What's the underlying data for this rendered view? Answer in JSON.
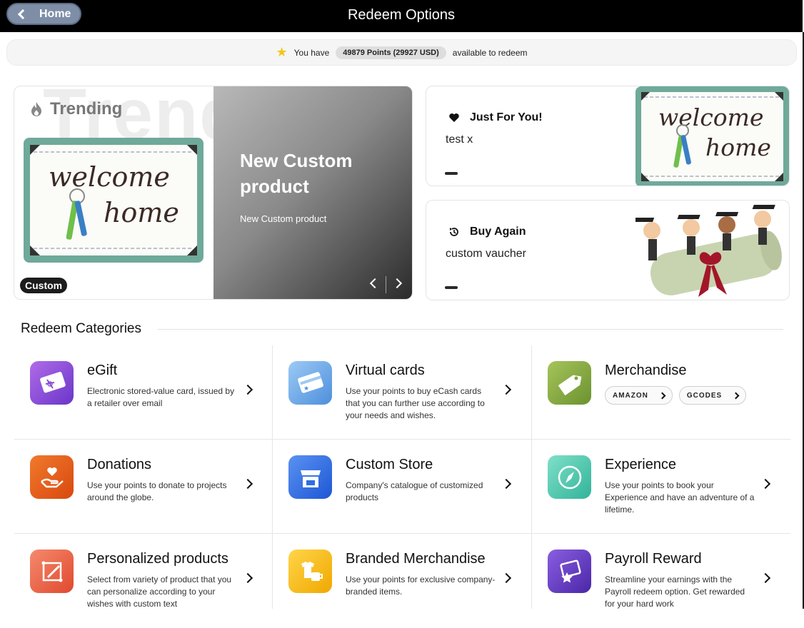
{
  "header": {
    "home_label": "Home",
    "title": "Redeem Options"
  },
  "points": {
    "prefix": "You have",
    "value": "49879 Points (29927 USD)",
    "suffix": "available to redeem"
  },
  "trending": {
    "bg_word": "Trending",
    "label": "Trending",
    "tag": "Custom",
    "product_title": "New Custom product",
    "product_subtitle": "New Custom product",
    "image_text": [
      "welcome",
      "home"
    ]
  },
  "cards": [
    {
      "title": "Just For You!",
      "subtitle": "test x",
      "icon": "heart-icon"
    },
    {
      "title": "Buy Again",
      "subtitle": "custom vaucher",
      "icon": "history-icon"
    }
  ],
  "categories_heading": "Redeem Categories",
  "categories": [
    {
      "title": "eGift",
      "desc": "Electronic stored-value card, issued by a retailer over email",
      "icon": "gift-card-icon",
      "color": "#8a4fd6"
    },
    {
      "title": "Virtual cards",
      "desc": "Use your points to buy eCash cards that you can further use according to your needs and wishes.",
      "icon": "credit-card-icon",
      "color": "#6fa8e8"
    },
    {
      "title": "Merchandise",
      "desc": "",
      "icon": "price-tag-icon",
      "color": "#7ea63a",
      "chips": [
        "AMAZON",
        "GCODES"
      ]
    },
    {
      "title": "Donations",
      "desc": "Use your points to donate to projects around the globe.",
      "icon": "hand-heart-icon",
      "color": "#e8571a"
    },
    {
      "title": "Custom Store",
      "desc": "Company's catalogue of customized products",
      "icon": "storefront-icon",
      "color": "#2f6fe0"
    },
    {
      "title": "Experience",
      "desc": "Use your points to book your Experience and have an adventure of a lifetime.",
      "icon": "compass-icon",
      "color": "#4cc9b0"
    },
    {
      "title": "Personalized products",
      "desc": "Select from variety of product that you can personalize according to your wishes with custom text",
      "icon": "personalize-icon",
      "color": "#ec6a4c"
    },
    {
      "title": "Branded Merchandise",
      "desc": "Use your points for exclusive company-branded items.",
      "icon": "tshirt-mug-icon",
      "color": "#f5b90f"
    },
    {
      "title": "Payroll Reward",
      "desc": "Streamline your earnings with the Payroll redeem option. Get rewarded for your hard work",
      "icon": "payroll-star-icon",
      "color": "#6a3fc4"
    }
  ],
  "colors": {
    "topbar": "#000000",
    "home_button": "#7e8ea6",
    "accent_star": "#f5c518"
  }
}
